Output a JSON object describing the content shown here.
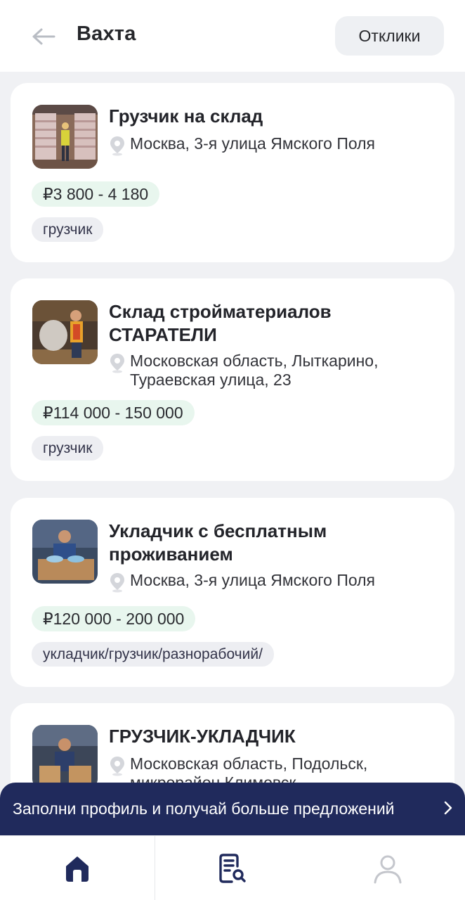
{
  "header": {
    "title": "Вахта",
    "responses_label": "Отклики"
  },
  "jobs": [
    {
      "title": "Грузчик на склад",
      "address": "Москва, 3-я улица Ямского Поля",
      "salary": "₽3 800 - 4 180",
      "tag": "грузчик"
    },
    {
      "title": "Склад стройматериалов СТАРАТЕЛИ",
      "address": "Московская область, Лыткарино, Тураевская улица, 23",
      "salary": "₽114 000 - 150 000",
      "tag": "грузчик"
    },
    {
      "title": "Укладчик с бесплатным проживанием",
      "address": "Москва, 3-я улица Ямского Поля",
      "salary": "₽120 000 - 200 000",
      "tag": "укладчик/грузчик/разнорабочий/"
    },
    {
      "title": "ГРУЗЧИК-УКЛАДЧИК",
      "address": "Московская область, Подольск, микрорайон Климовск"
    }
  ],
  "banner": {
    "text": "Заполни профиль и получай больше предложений"
  },
  "tabs": [
    {
      "icon": "home-icon",
      "active": true
    },
    {
      "icon": "search-resume-icon",
      "active": false
    },
    {
      "icon": "profile-icon",
      "active": false
    }
  ],
  "colors": {
    "accent": "#202a5c",
    "salary_bg": "#e8f6ee",
    "tag_bg": "#edeef2",
    "inactive_icon": "#c4c6cc"
  }
}
